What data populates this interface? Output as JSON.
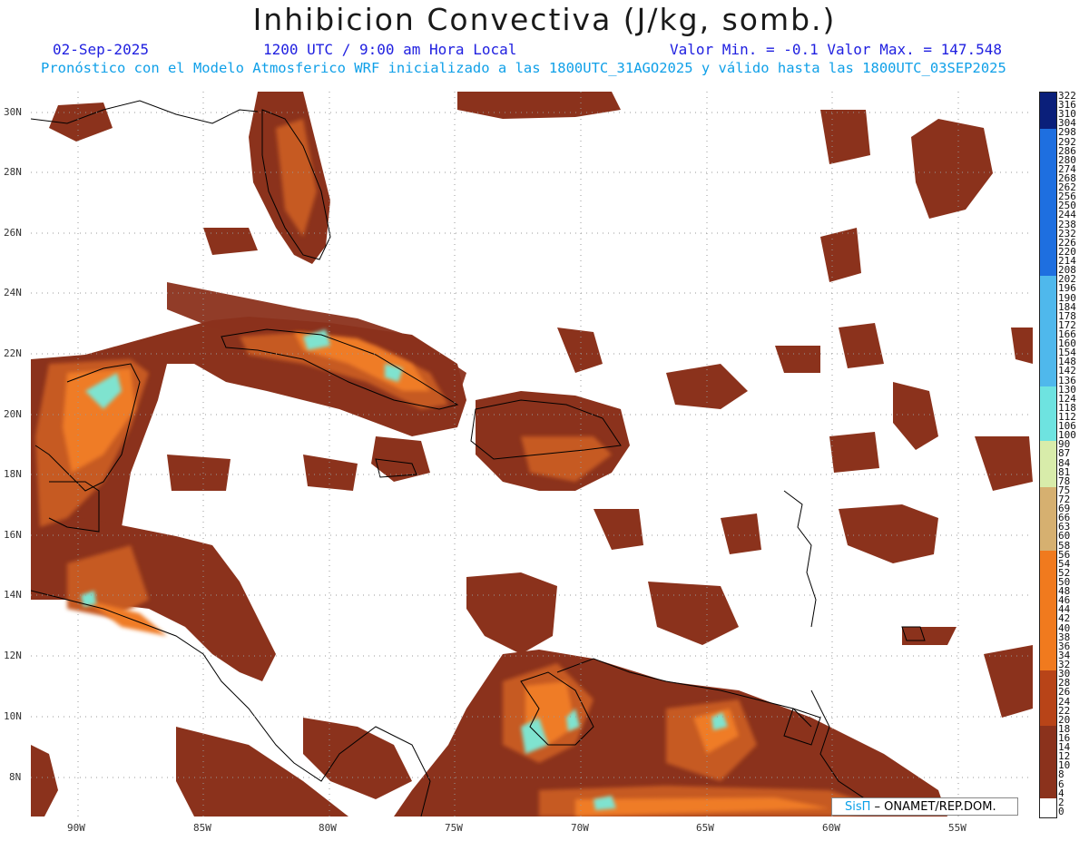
{
  "header": {
    "title": "Inhibicion Convectiva (J/kg, somb.)",
    "date": "02-Sep-2025",
    "time": "1200 UTC / 9:00 am Hora Local",
    "minmax": "Valor Min. = -0.1  Valor Max. = 147.548",
    "forecast": "Pronóstico con el Modelo Atmosferico WRF inicializado a las 1800UTC_31AGO2025 y válido hasta las  1800UTC_03SEP2025"
  },
  "axes": {
    "lat_labels": [
      "30N",
      "28N",
      "26N",
      "24N",
      "22N",
      "20N",
      "18N",
      "16N",
      "14N",
      "12N",
      "10N",
      "8N"
    ],
    "lon_labels": [
      "90W",
      "85W",
      "80W",
      "75W",
      "70W",
      "65W",
      "60W",
      "55W"
    ]
  },
  "colorbar": {
    "labels": [
      "322",
      "316",
      "310",
      "304",
      "298",
      "292",
      "286",
      "280",
      "274",
      "268",
      "262",
      "256",
      "250",
      "244",
      "238",
      "232",
      "226",
      "220",
      "214",
      "208",
      "202",
      "196",
      "190",
      "184",
      "178",
      "172",
      "166",
      "160",
      "154",
      "148",
      "142",
      "136",
      "130",
      "124",
      "118",
      "112",
      "106",
      "100",
      "90",
      "87",
      "84",
      "81",
      "78",
      "75",
      "72",
      "69",
      "66",
      "63",
      "60",
      "58",
      "56",
      "54",
      "52",
      "50",
      "48",
      "46",
      "44",
      "42",
      "40",
      "38",
      "36",
      "34",
      "32",
      "30",
      "28",
      "26",
      "24",
      "22",
      "20",
      "18",
      "16",
      "14",
      "12",
      "10",
      "8",
      "6",
      "4",
      "2",
      "0"
    ],
    "colors": {
      "top": "#0a1f7a",
      "blue": "#1e6fe0",
      "light_blue": "#4fb8ec",
      "cyan": "#6ee3e0",
      "pale_green": "#d8ecaa",
      "tan": "#d6b070",
      "orange": "#f07a1e",
      "rust": "#b84418",
      "brown": "#8b321c",
      "white": "#ffffff"
    }
  },
  "credit": {
    "brand": "SisΠ",
    "text": " – ONAMET/REP.DOM."
  },
  "map_colors": {
    "land_outline": "#000000",
    "grid": "#9a9a9a",
    "field_base": "#8b321c",
    "field_mid": "#c65a24",
    "field_high": "#ef7b28",
    "field_peak": "#7fe3cf"
  }
}
